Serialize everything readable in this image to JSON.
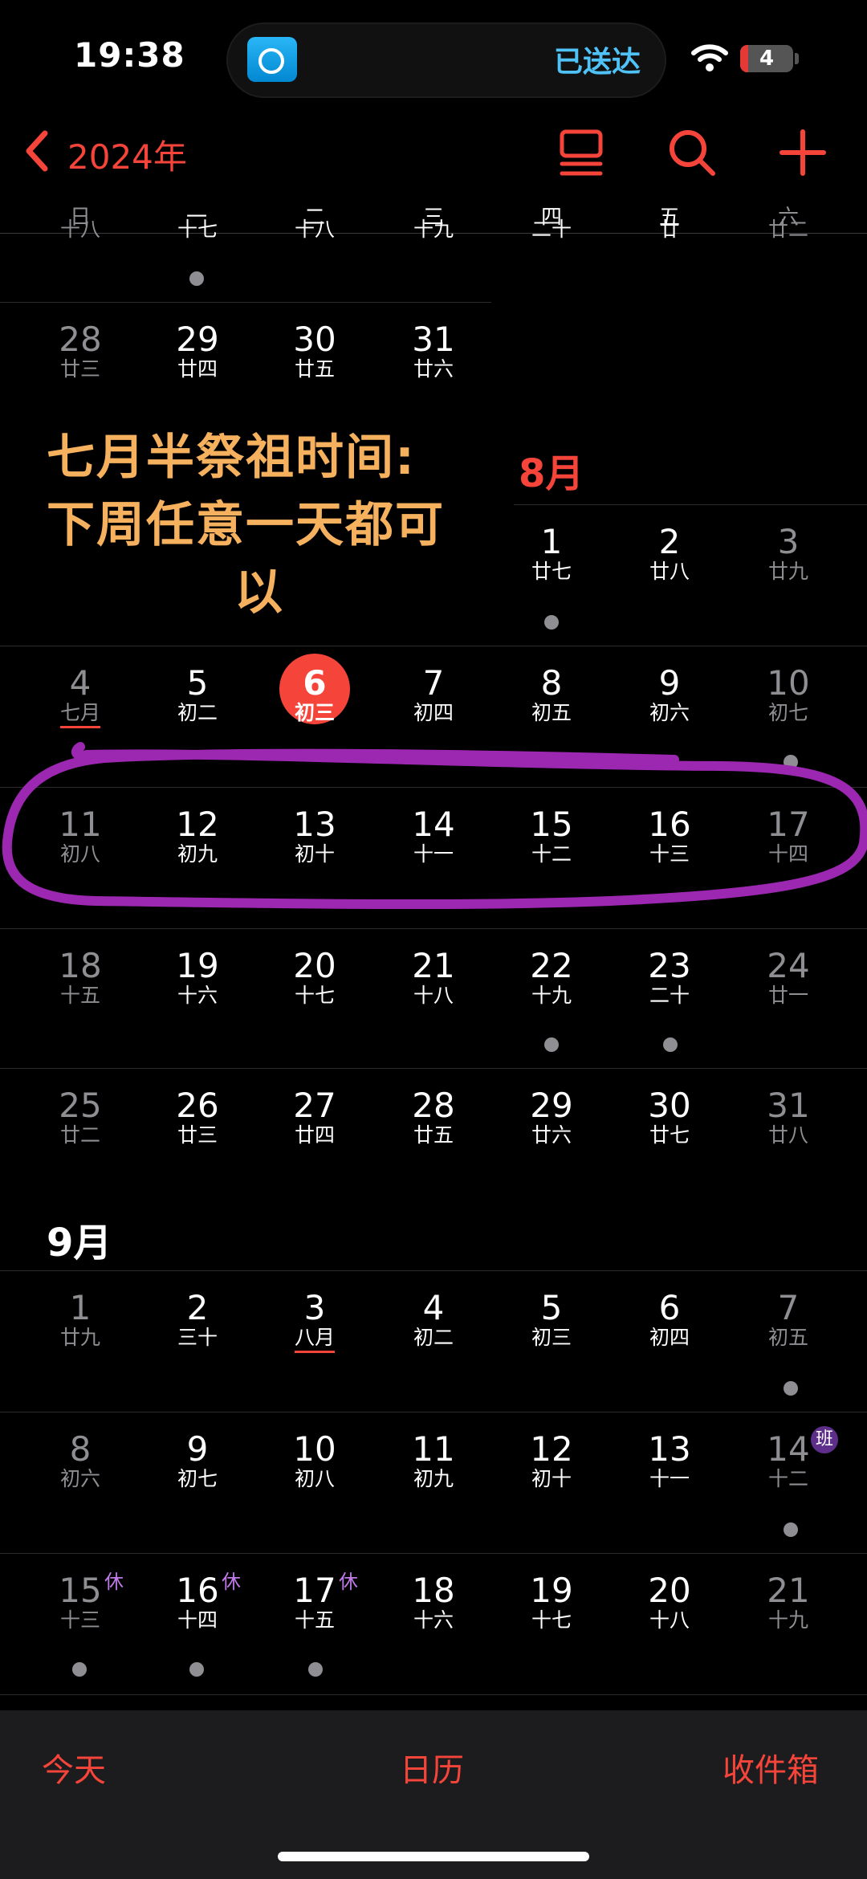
{
  "status": {
    "time": "19:38",
    "island_text": "已送达",
    "battery": "4"
  },
  "nav": {
    "year": "2024年"
  },
  "weekdays": [
    "日",
    "一",
    "二",
    "三",
    "四",
    "五",
    "六"
  ],
  "annotation": {
    "line1": "七月半祭祖时间:",
    "line2": "下周任意一天都可",
    "line3": "以"
  },
  "months": {
    "aug": "8月",
    "sep": "9月"
  },
  "july_partial": [
    "十八",
    "十七",
    "十八",
    "十九",
    "二十",
    "廿",
    "廿二"
  ],
  "july_last": [
    {
      "d": "28",
      "l": "廿三"
    },
    {
      "d": "29",
      "l": "廿四"
    },
    {
      "d": "30",
      "l": "廿五"
    },
    {
      "d": "31",
      "l": "廿六"
    }
  ],
  "aug_w1": [
    {
      "d": "1",
      "l": "廿七"
    },
    {
      "d": "2",
      "l": "廿八"
    },
    {
      "d": "3",
      "l": "廿九"
    }
  ],
  "aug_w2": [
    {
      "d": "4",
      "l": "七月"
    },
    {
      "d": "5",
      "l": "初二"
    },
    {
      "d": "6",
      "l": "初三"
    },
    {
      "d": "7",
      "l": "初四"
    },
    {
      "d": "8",
      "l": "初五"
    },
    {
      "d": "9",
      "l": "初六"
    },
    {
      "d": "10",
      "l": "初七"
    }
  ],
  "aug_w3": [
    {
      "d": "11",
      "l": "初八"
    },
    {
      "d": "12",
      "l": "初九"
    },
    {
      "d": "13",
      "l": "初十"
    },
    {
      "d": "14",
      "l": "十一"
    },
    {
      "d": "15",
      "l": "十二"
    },
    {
      "d": "16",
      "l": "十三"
    },
    {
      "d": "17",
      "l": "十四"
    }
  ],
  "aug_w4": [
    {
      "d": "18",
      "l": "十五"
    },
    {
      "d": "19",
      "l": "十六"
    },
    {
      "d": "20",
      "l": "十七"
    },
    {
      "d": "21",
      "l": "十八"
    },
    {
      "d": "22",
      "l": "十九"
    },
    {
      "d": "23",
      "l": "二十"
    },
    {
      "d": "24",
      "l": "廿一"
    }
  ],
  "aug_w5": [
    {
      "d": "25",
      "l": "廿二"
    },
    {
      "d": "26",
      "l": "廿三"
    },
    {
      "d": "27",
      "l": "廿四"
    },
    {
      "d": "28",
      "l": "廿五"
    },
    {
      "d": "29",
      "l": "廿六"
    },
    {
      "d": "30",
      "l": "廿七"
    },
    {
      "d": "31",
      "l": "廿八"
    }
  ],
  "sep_w1": [
    {
      "d": "1",
      "l": "廿九"
    },
    {
      "d": "2",
      "l": "三十"
    },
    {
      "d": "3",
      "l": "八月"
    },
    {
      "d": "4",
      "l": "初二"
    },
    {
      "d": "5",
      "l": "初三"
    },
    {
      "d": "6",
      "l": "初四"
    },
    {
      "d": "7",
      "l": "初五"
    }
  ],
  "sep_w2": [
    {
      "d": "8",
      "l": "初六"
    },
    {
      "d": "9",
      "l": "初七"
    },
    {
      "d": "10",
      "l": "初八"
    },
    {
      "d": "11",
      "l": "初九"
    },
    {
      "d": "12",
      "l": "初十"
    },
    {
      "d": "13",
      "l": "十一"
    },
    {
      "d": "14",
      "l": "十二"
    }
  ],
  "sep_w3": [
    {
      "d": "15",
      "l": "十三"
    },
    {
      "d": "16",
      "l": "十四"
    },
    {
      "d": "17",
      "l": "十五"
    },
    {
      "d": "18",
      "l": "十六"
    },
    {
      "d": "19",
      "l": "十七"
    },
    {
      "d": "20",
      "l": "十八"
    },
    {
      "d": "21",
      "l": "十九"
    }
  ],
  "badges": {
    "rest": "休",
    "work": "班"
  },
  "tabs": {
    "today": "今天",
    "calendars": "日历",
    "inbox": "收件箱"
  },
  "colors": {
    "accent": "#f5453a",
    "annotation": "#f6b15f",
    "circle": "#9c27b0"
  }
}
